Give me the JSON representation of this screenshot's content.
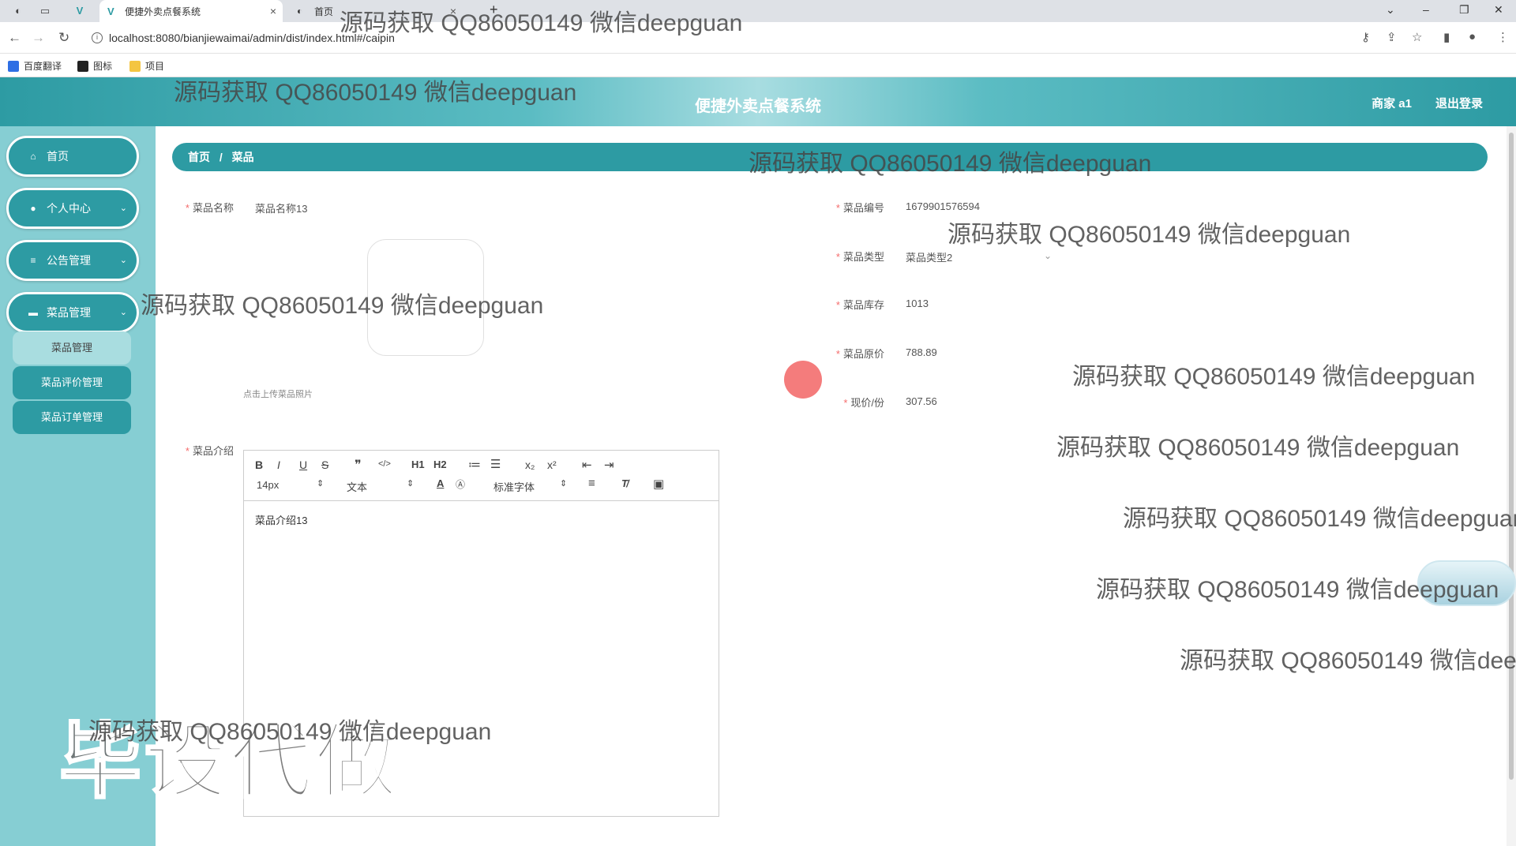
{
  "browser": {
    "tabs": [
      {
        "title": "便捷外卖点餐系统",
        "active": true
      },
      {
        "title": "首页",
        "active": false
      }
    ],
    "new_tab_label": "+",
    "close_label": "×",
    "url": "localhost:8080/bianjiewaimai/admin/dist/index.html#/caipin",
    "bookmarks": [
      {
        "label": "百度翻译",
        "color": "#2f6fe4"
      },
      {
        "label": "图标",
        "color": "#222222"
      },
      {
        "label": "项目",
        "color": "#f4c542"
      }
    ]
  },
  "header": {
    "title": "便捷外卖点餐系统",
    "user": "商家 a1",
    "logout": "退出登录"
  },
  "sidebar": {
    "items": [
      {
        "label": "首页",
        "icon": "home-icon"
      },
      {
        "label": "个人中心",
        "icon": "user-icon"
      },
      {
        "label": "公告管理",
        "icon": "list-icon"
      },
      {
        "label": "菜品管理",
        "icon": "monitor-icon"
      }
    ],
    "submenu": [
      {
        "label": "菜品管理",
        "active": true
      },
      {
        "label": "菜品评价管理",
        "active": false
      },
      {
        "label": "菜品订单管理",
        "active": false
      }
    ]
  },
  "breadcrumb": {
    "home": "首页",
    "separator": "/",
    "current": "菜品"
  },
  "form": {
    "name": {
      "label": "菜品名称",
      "value": "菜品名称13"
    },
    "number": {
      "label": "菜品编号",
      "value": "1679901576594"
    },
    "type": {
      "label": "菜品类型",
      "value": "菜品类型2"
    },
    "stock": {
      "label": "菜品库存",
      "value": "1013"
    },
    "original_price": {
      "label": "菜品原价",
      "value": "788.89"
    },
    "current_price": {
      "label": "现价/份",
      "value": "307.56"
    },
    "upload_hint": "点击上传菜品照片",
    "intro": {
      "label": "菜品介绍",
      "value": "菜品介绍13"
    },
    "required_mark": "*"
  },
  "editor": {
    "font_size": "14px",
    "text_style": "文本",
    "font_family": "标准字体",
    "buttons": [
      "B",
      "I",
      "U",
      "S",
      "❞",
      "</>",
      "H1",
      "H2",
      "≔",
      "☰",
      "x₂",
      "x²",
      "⇤",
      "⇥"
    ]
  },
  "watermarks": {
    "text": "源码获取 QQ86050149 微信deepguan",
    "big": "毕设代做"
  },
  "colors": {
    "primary": "#2d9ba3",
    "sidebar_bg": "#86ced3",
    "required": "#f56c6c"
  }
}
